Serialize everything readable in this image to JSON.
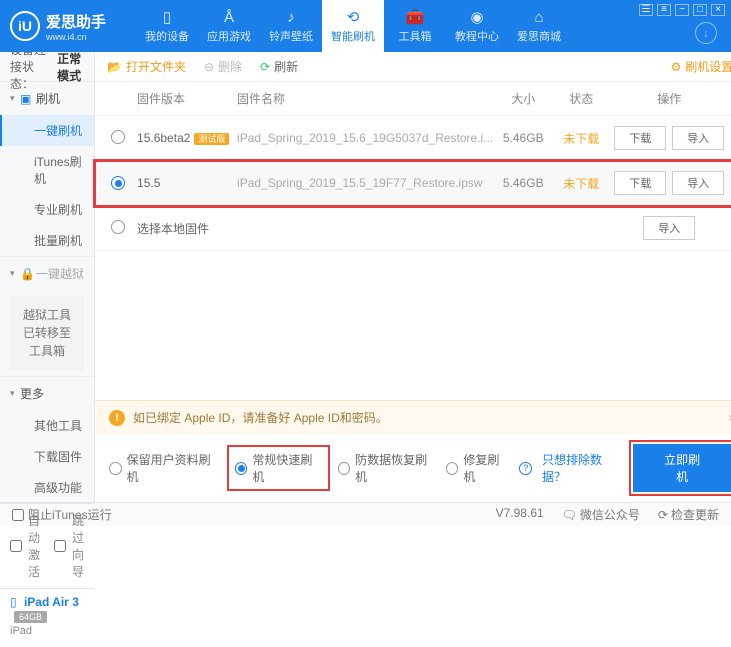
{
  "brand": {
    "icon_text": "iU",
    "title": "爱思助手",
    "url": "www.i4.cn"
  },
  "nav": [
    {
      "label": "我的设备"
    },
    {
      "label": "应用游戏"
    },
    {
      "label": "铃声壁纸"
    },
    {
      "label": "智能刷机"
    },
    {
      "label": "工具箱"
    },
    {
      "label": "教程中心"
    },
    {
      "label": "爱思商城"
    }
  ],
  "conn": {
    "label": "设备连接状态：",
    "value": "正常模式"
  },
  "sidebar": {
    "flash": {
      "title": "刷机",
      "items": [
        "一键刷机",
        "iTunes刷机",
        "专业刷机",
        "批量刷机"
      ]
    },
    "jailbreak": {
      "title": "一键越狱",
      "notice": "越狱工具已转移至\n工具箱"
    },
    "more": {
      "title": "更多",
      "items": [
        "其他工具",
        "下载固件",
        "高级功能"
      ]
    }
  },
  "auto": {
    "activate": "自动激活",
    "wizard": "跳过向导"
  },
  "device": {
    "name": "iPad Air 3",
    "storage": "64GB",
    "type": "iPad"
  },
  "toolbar": {
    "open": "打开文件夹",
    "delete": "删除",
    "refresh": "刷新",
    "settings": "刷机设置"
  },
  "table": {
    "headers": {
      "version": "固件版本",
      "name": "固件名称",
      "size": "大小",
      "status": "状态",
      "actions": "操作"
    },
    "rows": [
      {
        "version": "15.6beta2",
        "badge": "测试版",
        "filename": "iPad_Spring_2019_15.6_19G5037d_Restore.i...",
        "size": "5.46GB",
        "status": "未下载"
      },
      {
        "version": "15.5",
        "filename": "iPad_Spring_2019_15.5_19F77_Restore.ipsw",
        "size": "5.46GB",
        "status": "未下载"
      }
    ],
    "local": "选择本地固件",
    "download": "下载",
    "import": "导入"
  },
  "warning": "如已绑定 Apple ID，请准备好 Apple ID和密码。",
  "modes": {
    "keep": "保留用户资料刷机",
    "normal": "常规快速刷机",
    "recovery": "防数据恢复刷机",
    "repair": "修复刷机",
    "exclude": "只想排除数据？",
    "flash": "立即刷机"
  },
  "status": {
    "block": "阻止iTunes运行",
    "version": "V7.98.61",
    "wechat": "微信公众号",
    "update": "检查更新"
  }
}
